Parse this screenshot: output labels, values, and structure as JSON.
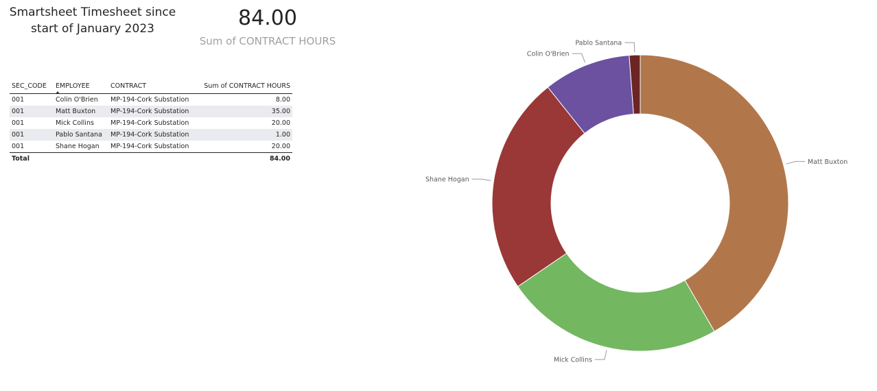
{
  "report": {
    "title_line1": "Smartsheet Timesheet since",
    "title_line2": "start of January 2023"
  },
  "kpi": {
    "value": "84.00",
    "label": "Sum of CONTRACT HOURS"
  },
  "table": {
    "columns": [
      "SEC_CODE",
      "EMPLOYEE",
      "CONTRACT",
      "Sum of CONTRACT HOURS"
    ],
    "sorted_column": "EMPLOYEE",
    "rows": [
      {
        "sec_code": "001",
        "employee": "Colin O'Brien",
        "contract": "MP-194-Cork Substation",
        "hours": "8.00"
      },
      {
        "sec_code": "001",
        "employee": "Matt Buxton",
        "contract": "MP-194-Cork Substation",
        "hours": "35.00"
      },
      {
        "sec_code": "001",
        "employee": "Mick Collins",
        "contract": "MP-194-Cork Substation",
        "hours": "20.00"
      },
      {
        "sec_code": "001",
        "employee": "Pablo Santana",
        "contract": "MP-194-Cork Substation",
        "hours": "1.00"
      },
      {
        "sec_code": "001",
        "employee": "Shane Hogan",
        "contract": "MP-194-Cork Substation",
        "hours": "20.00"
      }
    ],
    "total_label": "Total",
    "total_value": "84.00"
  },
  "chart_data": {
    "type": "pie",
    "donut": true,
    "categories": [
      "Matt Buxton",
      "Mick Collins",
      "Shane Hogan",
      "Colin O'Brien",
      "Pablo Santana"
    ],
    "values": [
      35,
      20,
      20,
      8,
      1
    ],
    "colors": [
      "#b1774b",
      "#73b761",
      "#9a3737",
      "#6b51a0",
      "#6b2525"
    ],
    "legend": "none (detail labels outside slices)"
  }
}
